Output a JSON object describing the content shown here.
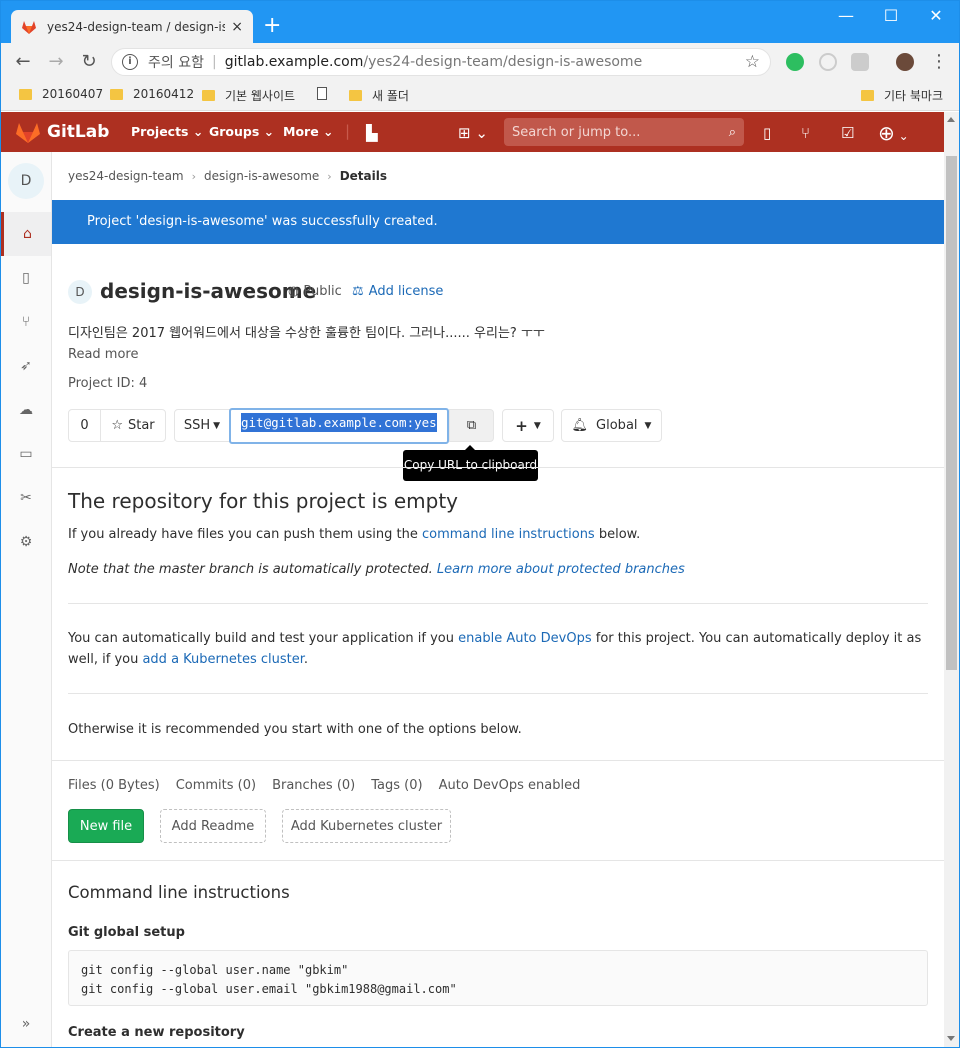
{
  "browser": {
    "tab_title": "yes24-design-team / design-is-a",
    "tab_close": "×",
    "new_tab": "+",
    "url_warning": "주의 요함",
    "url_sep": "|",
    "url_host": "gitlab.example.com",
    "url_path": "/yes24-design-team/design-is-awesome",
    "bookmarks": [
      "20160407",
      "20160412",
      "기본 웹사이트",
      "",
      "새 폴더"
    ],
    "other_bookmarks": "기타 북마크"
  },
  "gitlab": {
    "brand": "GitLab",
    "nav": [
      "Projects",
      "Groups",
      "More"
    ],
    "search_placeholder": "Search or jump to..."
  },
  "sidebar": {
    "avatar_letter": "D"
  },
  "breadcrumb": {
    "group": "yes24-design-team",
    "project": "design-is-awesome",
    "current": "Details"
  },
  "flash": "Project 'design-is-awesome' was successfully created.",
  "project": {
    "avatar_letter": "D",
    "name": "design-is-awesome",
    "visibility": "Public",
    "add_license": "Add license",
    "description": "디자인팀은 2017 웹어워드에서 대상을 수상한 훌륭한 팀이다. 그러나...... 우리는? ㅜㅜ",
    "read_more": "Read more",
    "project_id": "Project ID: 4",
    "star_count": "0",
    "star_label": "Star",
    "protocol": "SSH",
    "clone_url": "git@gitlab.example.com:yes",
    "notification": "Global",
    "tooltip": "Copy URL to clipboard"
  },
  "empty": {
    "title": "The repository for this project is empty",
    "p1_a": "If you already have files you can push them using the ",
    "p1_link": "command line instructions",
    "p1_b": " below.",
    "p2_a": "Note that the master branch is automatically protected. ",
    "p2_link": "Learn more about protected branches",
    "p3_a": "You can automatically build and test your application if you ",
    "p3_link1": "enable Auto DevOps",
    "p3_b": " for this project. You can automatically deploy it as well, if you ",
    "p3_link2": "add a Kubernetes cluster",
    "p3_c": ".",
    "p4": "Otherwise it is recommended you start with one of the options below."
  },
  "stats": [
    "Files (0 Bytes)",
    "Commits (0)",
    "Branches (0)",
    "Tags (0)",
    "Auto DevOps enabled"
  ],
  "actions": {
    "new_file": "New file",
    "add_readme": "Add Readme",
    "add_k8s": "Add Kubernetes cluster"
  },
  "cli": {
    "title": "Command line instructions",
    "global_setup": "Git global setup",
    "global_code": "git config --global user.name \"gbkim\"\ngit config --global user.email \"gbkim1988@gmail.com\"",
    "new_repo": "Create a new repository"
  }
}
